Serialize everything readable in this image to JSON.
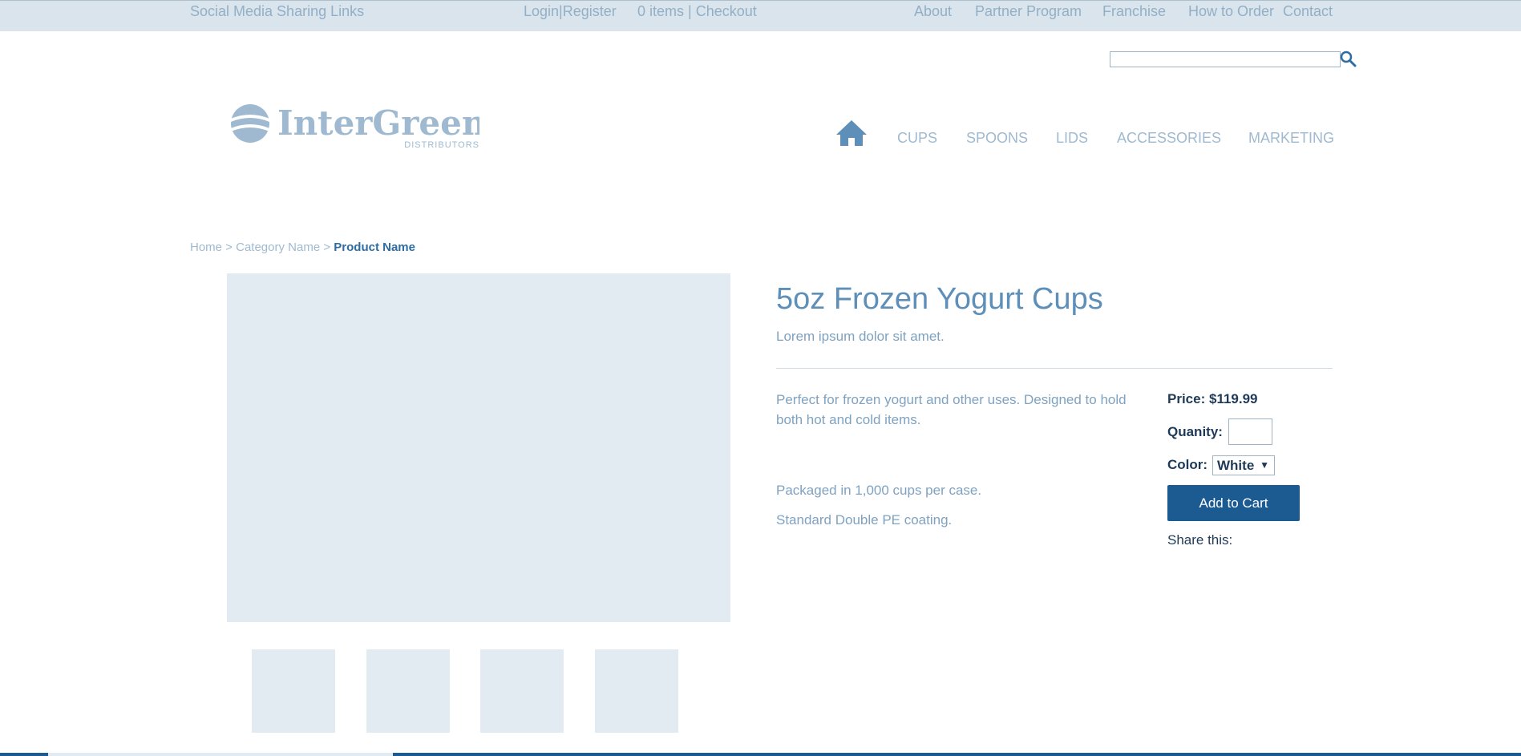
{
  "topbar": {
    "social": "Social Media Sharing Links",
    "login": "Login|Register",
    "cart": "0 items | Checkout",
    "about": "About",
    "partner": "Partner Program",
    "franchise": "Franchise",
    "how_to_order": "How to Order",
    "contact": "Contact"
  },
  "search": {
    "placeholder": ""
  },
  "logo": {
    "name": "InterGreen",
    "sub": "DISTRIBUTORS"
  },
  "nav": {
    "items": [
      "CUPS",
      "SPOONS",
      "LIDS",
      "ACCESSORIES",
      "MARKETING"
    ]
  },
  "breadcrumb": {
    "home": "Home",
    "sep": " > ",
    "category": "Category Name",
    "product": "Product Name"
  },
  "product": {
    "title": "5oz Frozen Yogurt Cups",
    "subtitle": "Lorem ipsum dolor sit amet.",
    "description": "Perfect for frozen yogurt and other uses. Designed to hold both hot and cold items.",
    "packaging": "Packaged in 1,000 cups per case.",
    "coating": "Standard Double PE coating."
  },
  "purchase": {
    "price_label": "Price:",
    "price": "$119.99",
    "quantity_label": "Quanity:",
    "color_label": "Color:",
    "color_value": "White",
    "add_to_cart": "Add to Cart",
    "share": "Share this:"
  },
  "colors": {
    "accent": "#1c5a92",
    "muted": "#9fbad0",
    "topbar": "#d9e4ec",
    "placeholder": "#e2eaf2"
  }
}
